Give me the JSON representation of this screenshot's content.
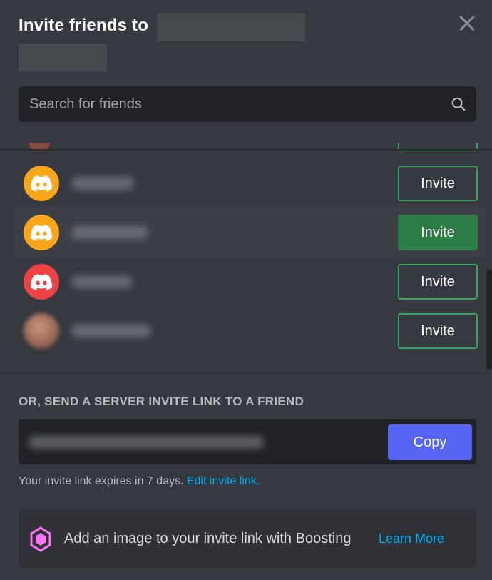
{
  "header": {
    "title": "Invite friends to"
  },
  "search": {
    "placeholder": "Search for friends"
  },
  "friends": [
    {
      "avatar_color": "#faa61a",
      "invite_label": "Invite",
      "hovered": false
    },
    {
      "avatar_color": "#faa61a",
      "invite_label": "Invite",
      "hovered": true
    },
    {
      "avatar_color": "#ed4245",
      "invite_label": "Invite",
      "hovered": false
    },
    {
      "avatar_color": "photo",
      "invite_label": "Invite",
      "hovered": false
    }
  ],
  "invite_link": {
    "section_label": "OR, SEND A SERVER INVITE LINK TO A FRIEND",
    "copy_label": "Copy",
    "expire_text": "Your invite link expires in 7 days.",
    "edit_link_label": "Edit invite link."
  },
  "boost": {
    "text": "Add an image to your invite link with Boosting",
    "learn_more": "Learn More"
  },
  "colors": {
    "background": "#36393f",
    "input": "#202225",
    "green": "#3ba55d",
    "blurple": "#5865f2",
    "link": "#00aff4"
  }
}
